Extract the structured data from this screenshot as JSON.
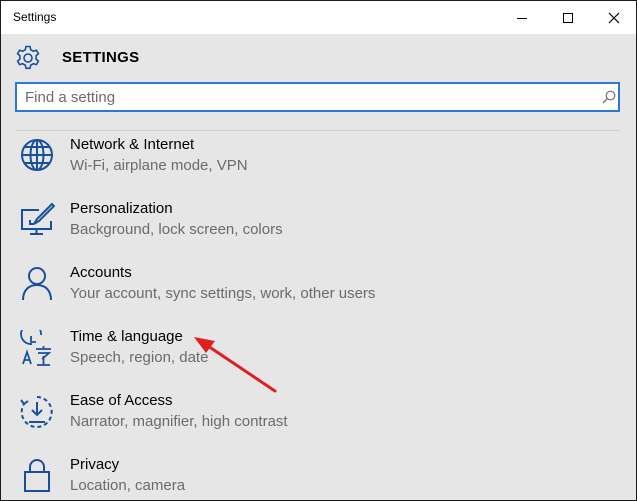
{
  "window": {
    "title": "Settings"
  },
  "header": {
    "title": "SETTINGS"
  },
  "search": {
    "placeholder": "Find a setting"
  },
  "items": [
    {
      "label": "Network & Internet",
      "description": "Wi-Fi, airplane mode, VPN",
      "icon": "globe-icon"
    },
    {
      "label": "Personalization",
      "description": "Background, lock screen, colors",
      "icon": "personalization-icon"
    },
    {
      "label": "Accounts",
      "description": "Your account, sync settings, work, other users",
      "icon": "person-icon"
    },
    {
      "label": "Time & language",
      "description": "Speech, region, date",
      "icon": "time-language-icon"
    },
    {
      "label": "Ease of Access",
      "description": "Narrator, magnifier, high contrast",
      "icon": "ease-of-access-icon"
    },
    {
      "label": "Privacy",
      "description": "Location, camera",
      "icon": "lock-icon"
    }
  ],
  "colors": {
    "accent": "#2a7ad4",
    "icon": "#1a4f9c",
    "annotation_arrow": "#e02020"
  }
}
